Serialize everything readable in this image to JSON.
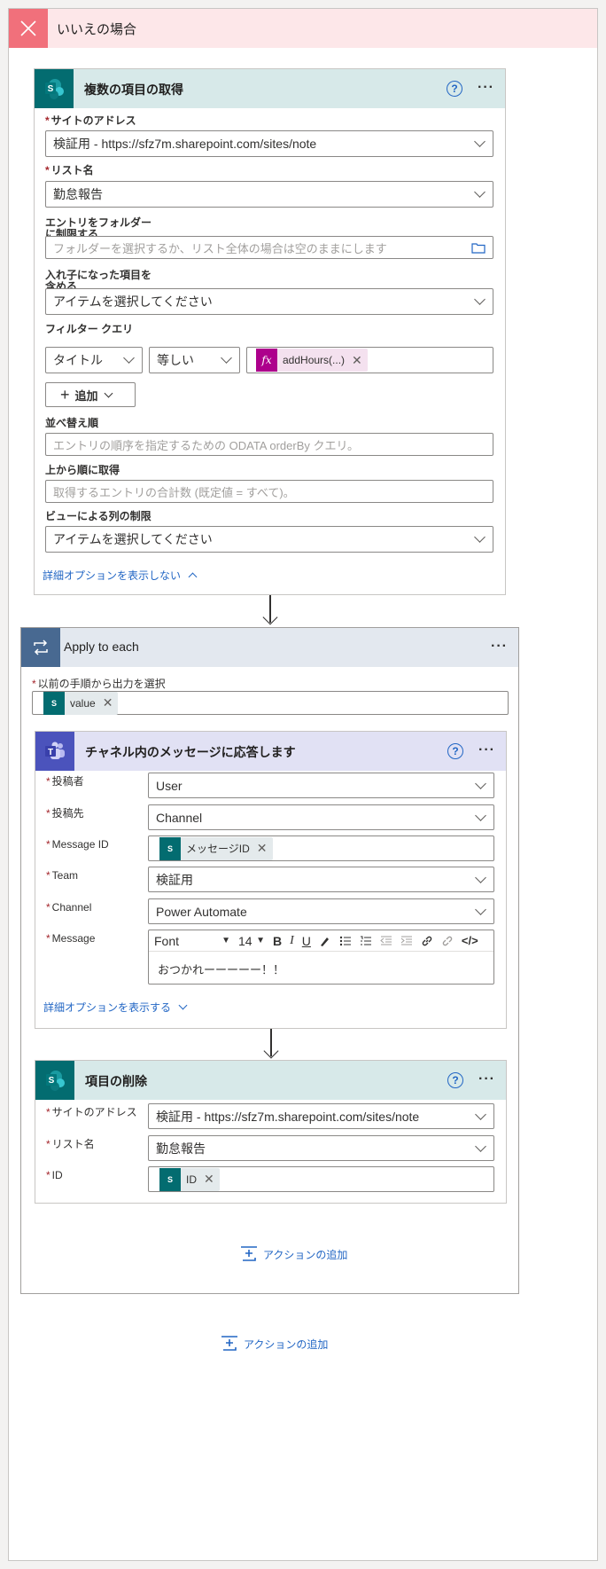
{
  "branch": {
    "title": "いいえの場合"
  },
  "get_items": {
    "title": "複数の項目の取得",
    "help": "?",
    "more": "···",
    "site_label": "サイトのアドレス",
    "site_value": "検証用 - https://sfz7m.sharepoint.com/sites/note",
    "list_label": "リスト名",
    "list_value": "勤怠報告",
    "folder_label": "エントリをフォルダー\nに制限する",
    "folder_placeholder": "フォルダーを選択するか、リスト全体の場合は空のままにします",
    "nested_label": "入れ子になった項目を\n含める",
    "nested_value": "アイテムを選択してください",
    "filter_label": "フィルター クエリ",
    "filter_field": "タイトル",
    "filter_op": "等しい",
    "filter_token": "addHours(...)",
    "add_button": "追加",
    "orderby_label": "並べ替え順",
    "orderby_placeholder": "エントリの順序を指定するための ODATA orderBy クエリ。",
    "top_label": "上から順に取得",
    "top_placeholder": "取得するエントリの合計数 (既定値 = すべて)。",
    "view_label": "ビューによる列の制限",
    "view_value": "アイテムを選択してください",
    "hide_advanced": "詳細オプションを表示しない"
  },
  "apply_each": {
    "title": "Apply to each",
    "more": "···",
    "select_label": "以前の手順から出力を選択",
    "token": "value"
  },
  "teams_reply": {
    "title": "チャネル内のメッセージに応答します",
    "help": "?",
    "more": "···",
    "poster_label": "投稿者",
    "poster_value": "User",
    "post_in_label": "投稿先",
    "post_in_value": "Channel",
    "msgid_label": "Message ID",
    "msgid_token": "メッセージID",
    "team_label": "Team",
    "team_value": "検証用",
    "channel_label": "Channel",
    "channel_value": "Power Automate",
    "message_label": "Message",
    "font_name": "Font",
    "font_size": "14",
    "message_body": "おつかれーーーーー！！",
    "show_advanced": "詳細オプションを表示する"
  },
  "delete_item": {
    "title": "項目の削除",
    "help": "?",
    "more": "···",
    "site_label": "サイトのアドレス",
    "site_value": "検証用 - https://sfz7m.sharepoint.com/sites/note",
    "list_label": "リスト名",
    "list_value": "勤怠報告",
    "id_label": "ID",
    "id_token": "ID"
  },
  "add_action_inner": "アクションの追加",
  "add_action_outer": "アクションの追加",
  "colors": {
    "sharepoint": "#036c70",
    "teams": "#4b53bc",
    "loop": "#486991",
    "link": "#2266c4",
    "no_branch": "#f1707b"
  }
}
